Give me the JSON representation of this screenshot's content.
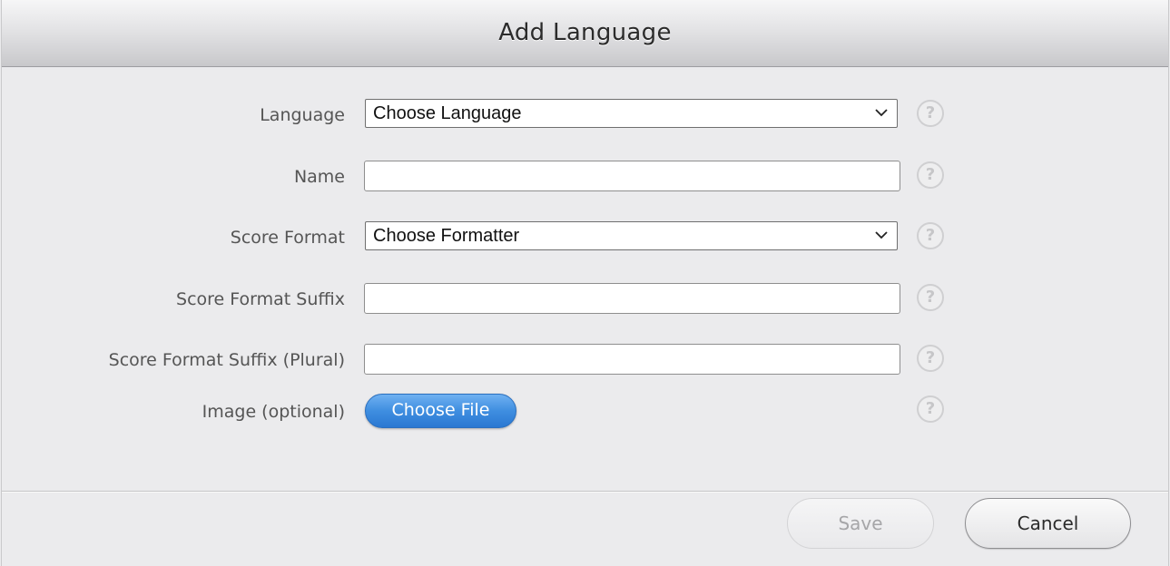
{
  "dialog": {
    "title": "Add Language"
  },
  "form": {
    "language": {
      "label": "Language",
      "selected": "Choose Language"
    },
    "name": {
      "label": "Name",
      "value": ""
    },
    "score_format": {
      "label": "Score Format",
      "selected": "Choose Formatter"
    },
    "score_format_suffix": {
      "label": "Score Format Suffix",
      "value": ""
    },
    "score_format_suffix_plural": {
      "label": "Score Format Suffix (Plural)",
      "value": ""
    },
    "image": {
      "label": "Image (optional)",
      "button_label": "Choose File"
    },
    "help_glyph": "?"
  },
  "footer": {
    "save_label": "Save",
    "save_enabled": false,
    "cancel_label": "Cancel"
  },
  "icons": {
    "help": "help-circle-icon",
    "chevron": "chevron-down-icon"
  },
  "colors": {
    "accent": "#3f8ee0",
    "background": "#ebebed"
  }
}
